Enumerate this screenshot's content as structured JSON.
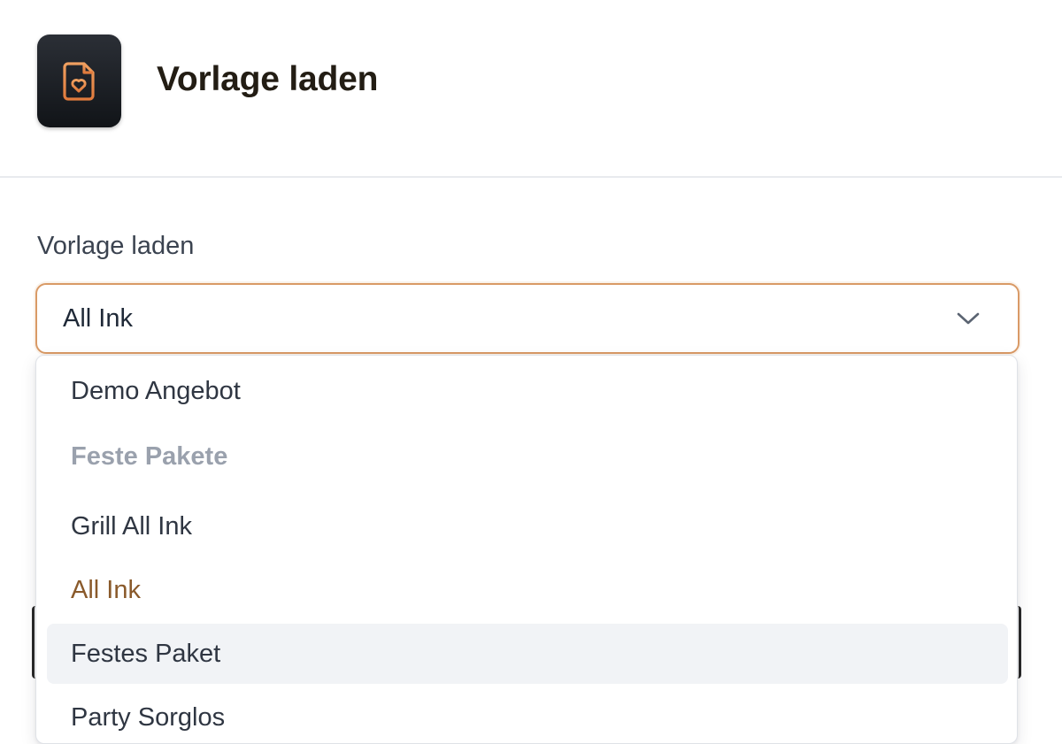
{
  "header": {
    "title": "Vorlage laden",
    "icon": "file-heart-icon",
    "icon_color": "#e8884a"
  },
  "form": {
    "label": "Vorlage laden",
    "select": {
      "value": "All Ink",
      "border_color": "#d99a66"
    }
  },
  "dropdown": {
    "options": [
      {
        "label": "Demo Angebot",
        "kind": "option"
      },
      {
        "label": "Feste Pakete",
        "kind": "group-label"
      },
      {
        "label": "Grill All Ink",
        "kind": "option"
      },
      {
        "label": "All Ink",
        "kind": "option",
        "selected": true
      },
      {
        "label": "Festes Paket",
        "kind": "option",
        "hovered": true
      },
      {
        "label": "Party Sorglos",
        "kind": "option"
      }
    ]
  }
}
